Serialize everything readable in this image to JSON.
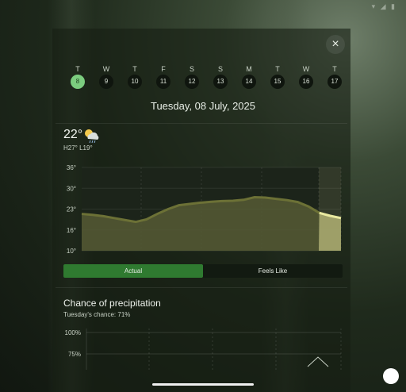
{
  "status_bar": {
    "icons": "▾ ◢ ▮"
  },
  "close": {
    "icon": "×"
  },
  "days": [
    {
      "dow": "T",
      "num": "8",
      "selected": true
    },
    {
      "dow": "W",
      "num": "9"
    },
    {
      "dow": "T",
      "num": "10"
    },
    {
      "dow": "F",
      "num": "11"
    },
    {
      "dow": "S",
      "num": "12"
    },
    {
      "dow": "S",
      "num": "13"
    },
    {
      "dow": "M",
      "num": "14"
    },
    {
      "dow": "T",
      "num": "15"
    },
    {
      "dow": "W",
      "num": "16"
    },
    {
      "dow": "T",
      "num": "17"
    }
  ],
  "date_title": "Tuesday, 08 July, 2025",
  "current": {
    "temp": "22°",
    "hilo": "H27° L19°",
    "icon": "partly-cloudy-rain-icon"
  },
  "chart_data": {
    "type": "area",
    "yticks": [
      "36°",
      "30°",
      "23°",
      "16°",
      "10°"
    ],
    "ylim": [
      10,
      36
    ],
    "x": [
      0,
      1,
      2,
      3,
      4,
      5,
      6,
      7,
      8,
      9,
      10,
      11,
      12,
      13,
      14,
      15,
      16,
      17,
      18,
      19,
      20,
      21,
      22,
      23,
      24
    ],
    "series": [
      {
        "values": [
          21.5,
          21.2,
          20.8,
          20.2,
          19.6,
          19.0,
          19.8,
          21.5,
          23.0,
          24.2,
          24.6,
          25.0,
          25.3,
          25.5,
          25.6,
          25.9,
          26.7,
          26.6,
          26.2,
          25.8,
          25.2,
          23.8,
          21.8,
          20.9,
          20.2
        ]
      }
    ],
    "grid": true,
    "forecast_region": "right-end"
  },
  "toggle": {
    "actual": "Actual",
    "feels_like": "Feels Like",
    "selected": "actual"
  },
  "precip": {
    "title": "Chance of precipitation",
    "subtitle": "Tuesday's chance: 71%",
    "yticks": [
      "100%",
      "75%"
    ]
  },
  "colors": {
    "accent": "#2f7a30",
    "selected_day": "#7ccd7f",
    "area_fill": "#565a35",
    "line": "#6c7136",
    "forecast_line": "#e9e9a0"
  }
}
